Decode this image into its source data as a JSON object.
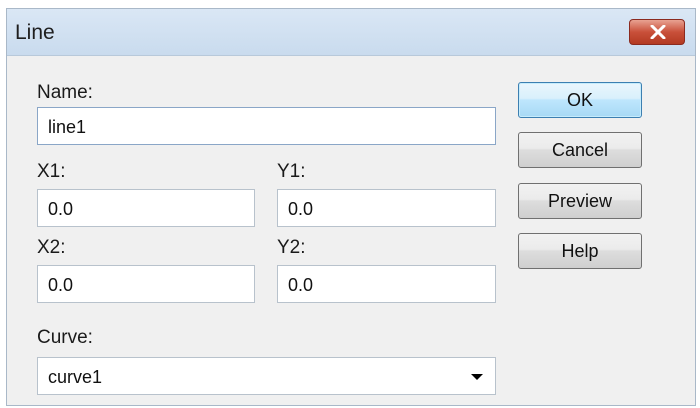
{
  "window": {
    "title": "Line"
  },
  "form": {
    "name_label": "Name:",
    "name_value": "line1",
    "x1_label": "X1:",
    "x1_value": "0.0",
    "y1_label": "Y1:",
    "y1_value": "0.0",
    "x2_label": "X2:",
    "x2_value": "0.0",
    "y2_label": "Y2:",
    "y2_value": "0.0",
    "curve_label": "Curve:",
    "curve_value": "curve1"
  },
  "buttons": {
    "ok": "OK",
    "cancel": "Cancel",
    "preview": "Preview",
    "help": "Help"
  },
  "icons": {
    "close": "close-icon",
    "dropdown": "chevron-down-icon"
  },
  "colors": {
    "close_button": "#c9503a",
    "default_button": "#bee6fd",
    "titlebar": "#dae7f5"
  }
}
